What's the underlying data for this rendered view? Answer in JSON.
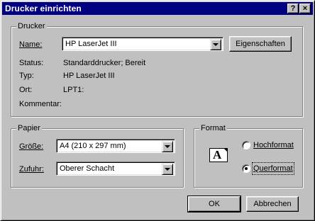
{
  "window": {
    "title": "Drucker einrichten",
    "help_button": "?",
    "close_button": "×"
  },
  "printer": {
    "group_label": "Drucker",
    "name_label": "Name:",
    "name_value": "HP LaserJet III",
    "properties_button": "Eigenschaften",
    "status_label": "Status:",
    "status_value": "Standarddrucker; Bereit",
    "type_label": "Typ:",
    "type_value": "HP LaserJet III",
    "location_label": "Ort:",
    "location_value": "LPT1:",
    "comment_label": "Kommentar:",
    "comment_value": ""
  },
  "paper": {
    "group_label": "Papier",
    "size_label": "Größe:",
    "size_value": "A4 (210 x 297 mm)",
    "source_label": "Zufuhr:",
    "source_value": "Oberer Schacht"
  },
  "orientation": {
    "group_label": "Format",
    "icon_glyph": "A",
    "portrait_label": "Hochformat",
    "landscape_label": "Querformat",
    "selected": "Querformat"
  },
  "buttons": {
    "ok": "OK",
    "cancel": "Abbrechen"
  }
}
